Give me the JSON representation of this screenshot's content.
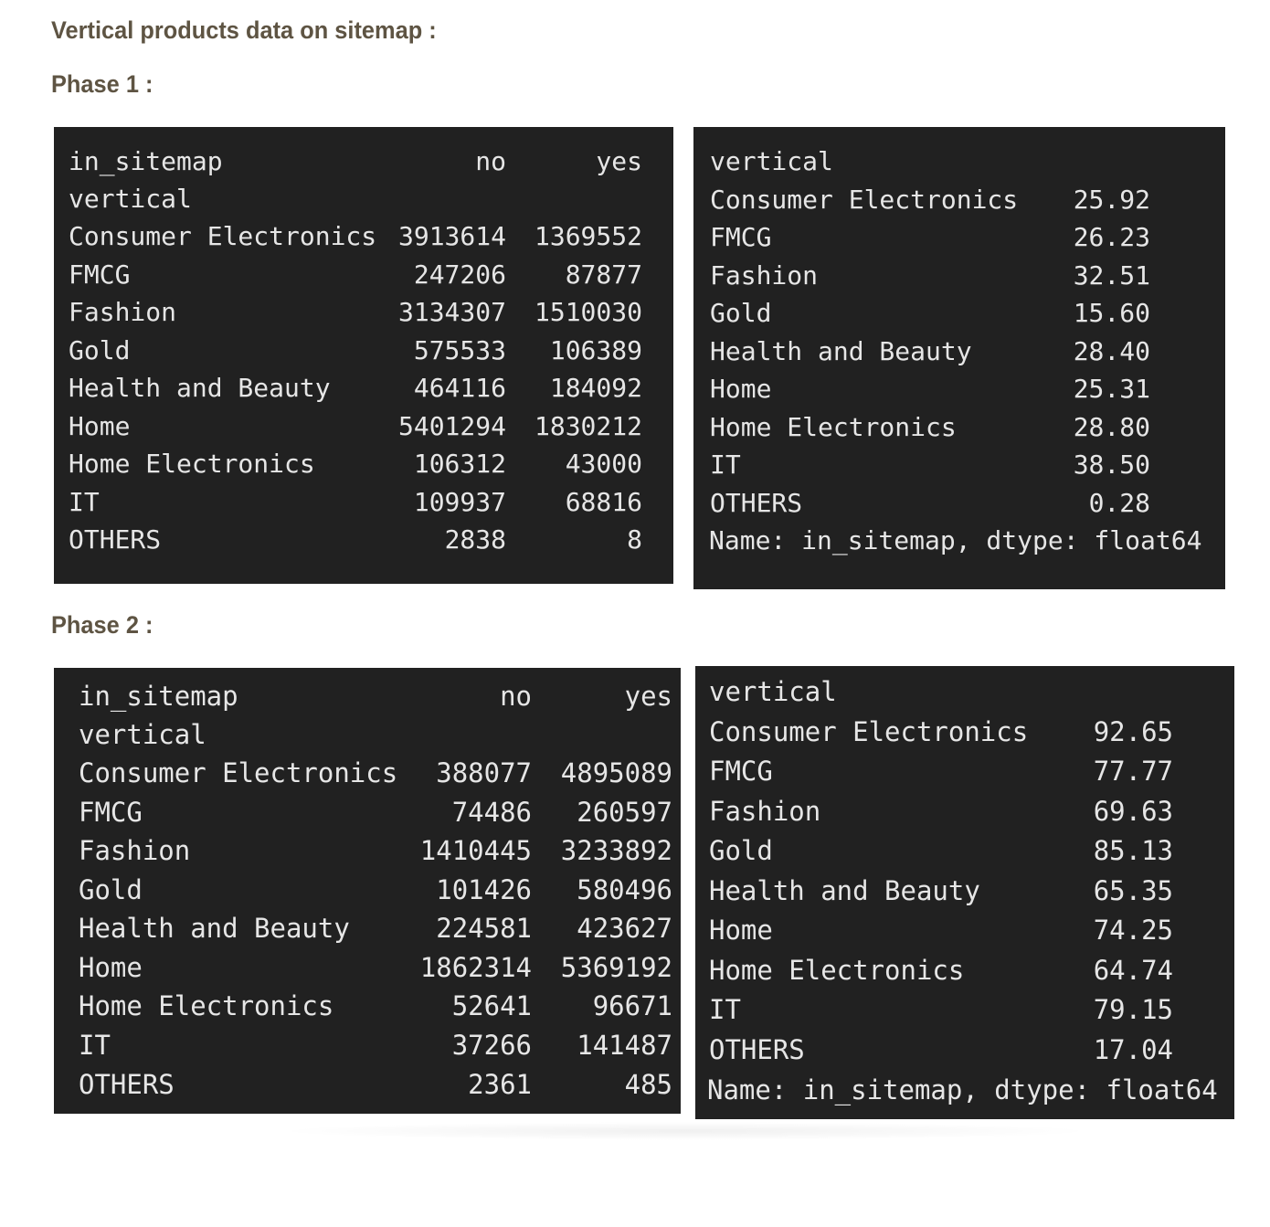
{
  "page": {
    "title": "Vertical products data on sitemap :"
  },
  "phases": [
    {
      "label": "Phase 1 :",
      "counts": {
        "header": {
          "index_name": "in_sitemap",
          "col_no": "no",
          "col_yes": "yes"
        },
        "index_label": "vertical",
        "rows": [
          {
            "name": "Consumer Electronics",
            "no": "3913614",
            "yes": "1369552"
          },
          {
            "name": "FMCG",
            "no": "247206",
            "yes": "87877"
          },
          {
            "name": "Fashion",
            "no": "3134307",
            "yes": "1510030"
          },
          {
            "name": "Gold",
            "no": "575533",
            "yes": "106389"
          },
          {
            "name": "Health and Beauty",
            "no": "464116",
            "yes": "184092"
          },
          {
            "name": "Home",
            "no": "5401294",
            "yes": "1830212"
          },
          {
            "name": "Home Electronics",
            "no": "106312",
            "yes": "43000"
          },
          {
            "name": "IT",
            "no": "109937",
            "yes": "68816"
          },
          {
            "name": "OTHERS",
            "no": "2838",
            "yes": "8"
          }
        ]
      },
      "percent": {
        "index_label": "vertical",
        "rows": [
          {
            "name": "Consumer Electronics",
            "value": "25.92"
          },
          {
            "name": "FMCG",
            "value": "26.23"
          },
          {
            "name": "Fashion",
            "value": "32.51"
          },
          {
            "name": "Gold",
            "value": "15.60"
          },
          {
            "name": "Health and Beauty",
            "value": "28.40"
          },
          {
            "name": "Home",
            "value": "25.31"
          },
          {
            "name": "Home Electronics",
            "value": "28.80"
          },
          {
            "name": "IT",
            "value": "38.50"
          },
          {
            "name": "OTHERS",
            "value": "0.28"
          }
        ],
        "footer": "Name: in_sitemap, dtype: float64"
      }
    },
    {
      "label": "Phase 2 :",
      "counts": {
        "header": {
          "index_name": "in_sitemap",
          "col_no": "no",
          "col_yes": "yes"
        },
        "index_label": "vertical",
        "rows": [
          {
            "name": "Consumer Electronics",
            "no": "388077",
            "yes": "4895089"
          },
          {
            "name": "FMCG",
            "no": "74486",
            "yes": "260597"
          },
          {
            "name": "Fashion",
            "no": "1410445",
            "yes": "3233892"
          },
          {
            "name": "Gold",
            "no": "101426",
            "yes": "580496"
          },
          {
            "name": "Health and Beauty",
            "no": "224581",
            "yes": "423627"
          },
          {
            "name": "Home",
            "no": "1862314",
            "yes": "5369192"
          },
          {
            "name": "Home Electronics",
            "no": "52641",
            "yes": "96671"
          },
          {
            "name": "IT",
            "no": "37266",
            "yes": "141487"
          },
          {
            "name": "OTHERS",
            "no": "2361",
            "yes": "485"
          }
        ]
      },
      "percent": {
        "index_label": "vertical",
        "rows": [
          {
            "name": "Consumer Electronics",
            "value": "92.65"
          },
          {
            "name": "FMCG",
            "value": "77.77"
          },
          {
            "name": "Fashion",
            "value": "69.63"
          },
          {
            "name": "Gold",
            "value": "85.13"
          },
          {
            "name": "Health and Beauty",
            "value": "65.35"
          },
          {
            "name": "Home",
            "value": "74.25"
          },
          {
            "name": "Home Electronics",
            "value": "64.74"
          },
          {
            "name": "IT",
            "value": "79.15"
          },
          {
            "name": "OTHERS",
            "value": "17.04"
          }
        ],
        "footer": "Name: in_sitemap, dtype: float64"
      }
    }
  ]
}
